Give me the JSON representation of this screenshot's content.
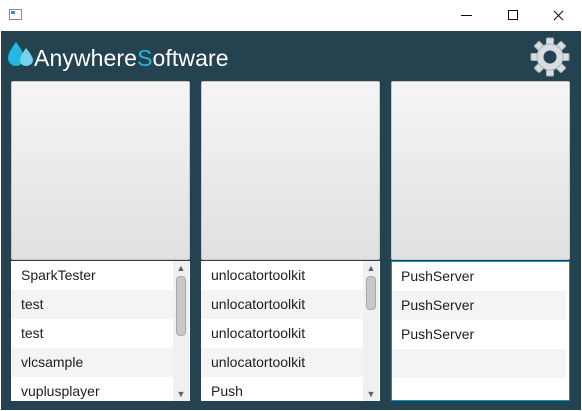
{
  "window": {
    "icon": "app-window-icon",
    "controls": [
      "minimize-icon",
      "maximize-icon",
      "close-icon"
    ]
  },
  "brand": {
    "part1": "Anywhere",
    "part2": "S",
    "part3": "oftware",
    "logo_icon": "water-drops-icon",
    "accent_color": "#22b8df",
    "background_color": "#24424f"
  },
  "settings": {
    "icon": "gear-icon"
  },
  "panels": [
    {
      "items": [
        "SparkTester",
        "test",
        "test",
        "vlcsample",
        "vuplusplayer"
      ]
    },
    {
      "items": [
        "unlocatortoolkit",
        "unlocatortoolkit",
        "unlocatortoolkit",
        "unlocatortoolkit",
        "Push"
      ]
    },
    {
      "items": [
        "PushServer",
        "PushServer",
        "PushServer"
      ]
    }
  ],
  "scrollbar": {
    "up_arrow": "▲",
    "down_arrow": "▼"
  }
}
